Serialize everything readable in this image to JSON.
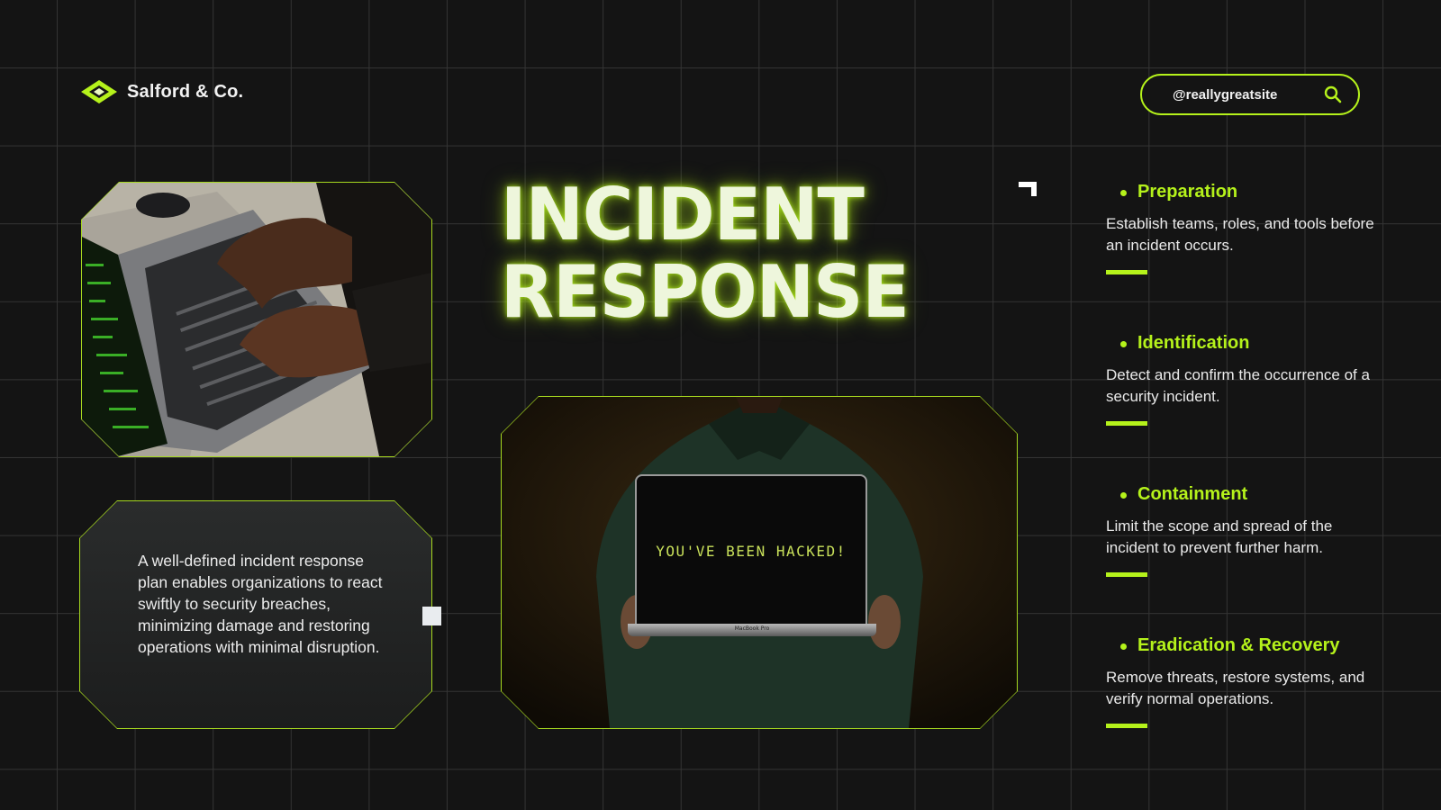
{
  "brand": {
    "name": "Salford & Co.",
    "logo_icon": "diamond-logo-icon"
  },
  "search": {
    "handle": "@reallygreatsite",
    "icon": "search-icon"
  },
  "title": {
    "line1": "INCIDENT",
    "line2": "RESPONSE"
  },
  "intro_text": "A well-defined incident response plan enables organizations to react swiftly to security breaches, minimizing damage and restoring operations with minimal disruption.",
  "photo_hacked": {
    "screen_text": "YOU'VE BEEN HACKED!",
    "device_label": "MacBook Pro"
  },
  "steps": [
    {
      "title": "Preparation",
      "desc": "Establish teams, roles, and tools before an incident occurs."
    },
    {
      "title": "Identification",
      "desc": "Detect and confirm the occurrence of a security incident."
    },
    {
      "title": "Containment",
      "desc": "Limit the scope and spread of the incident to prevent further harm."
    },
    {
      "title": "Eradication & Recovery",
      "desc": "Remove threats, restore systems, and verify normal operations."
    }
  ],
  "colors": {
    "accent": "#b5f21b",
    "background": "#141414",
    "grid": "#3a3a3a",
    "text": "#eaeaea"
  }
}
